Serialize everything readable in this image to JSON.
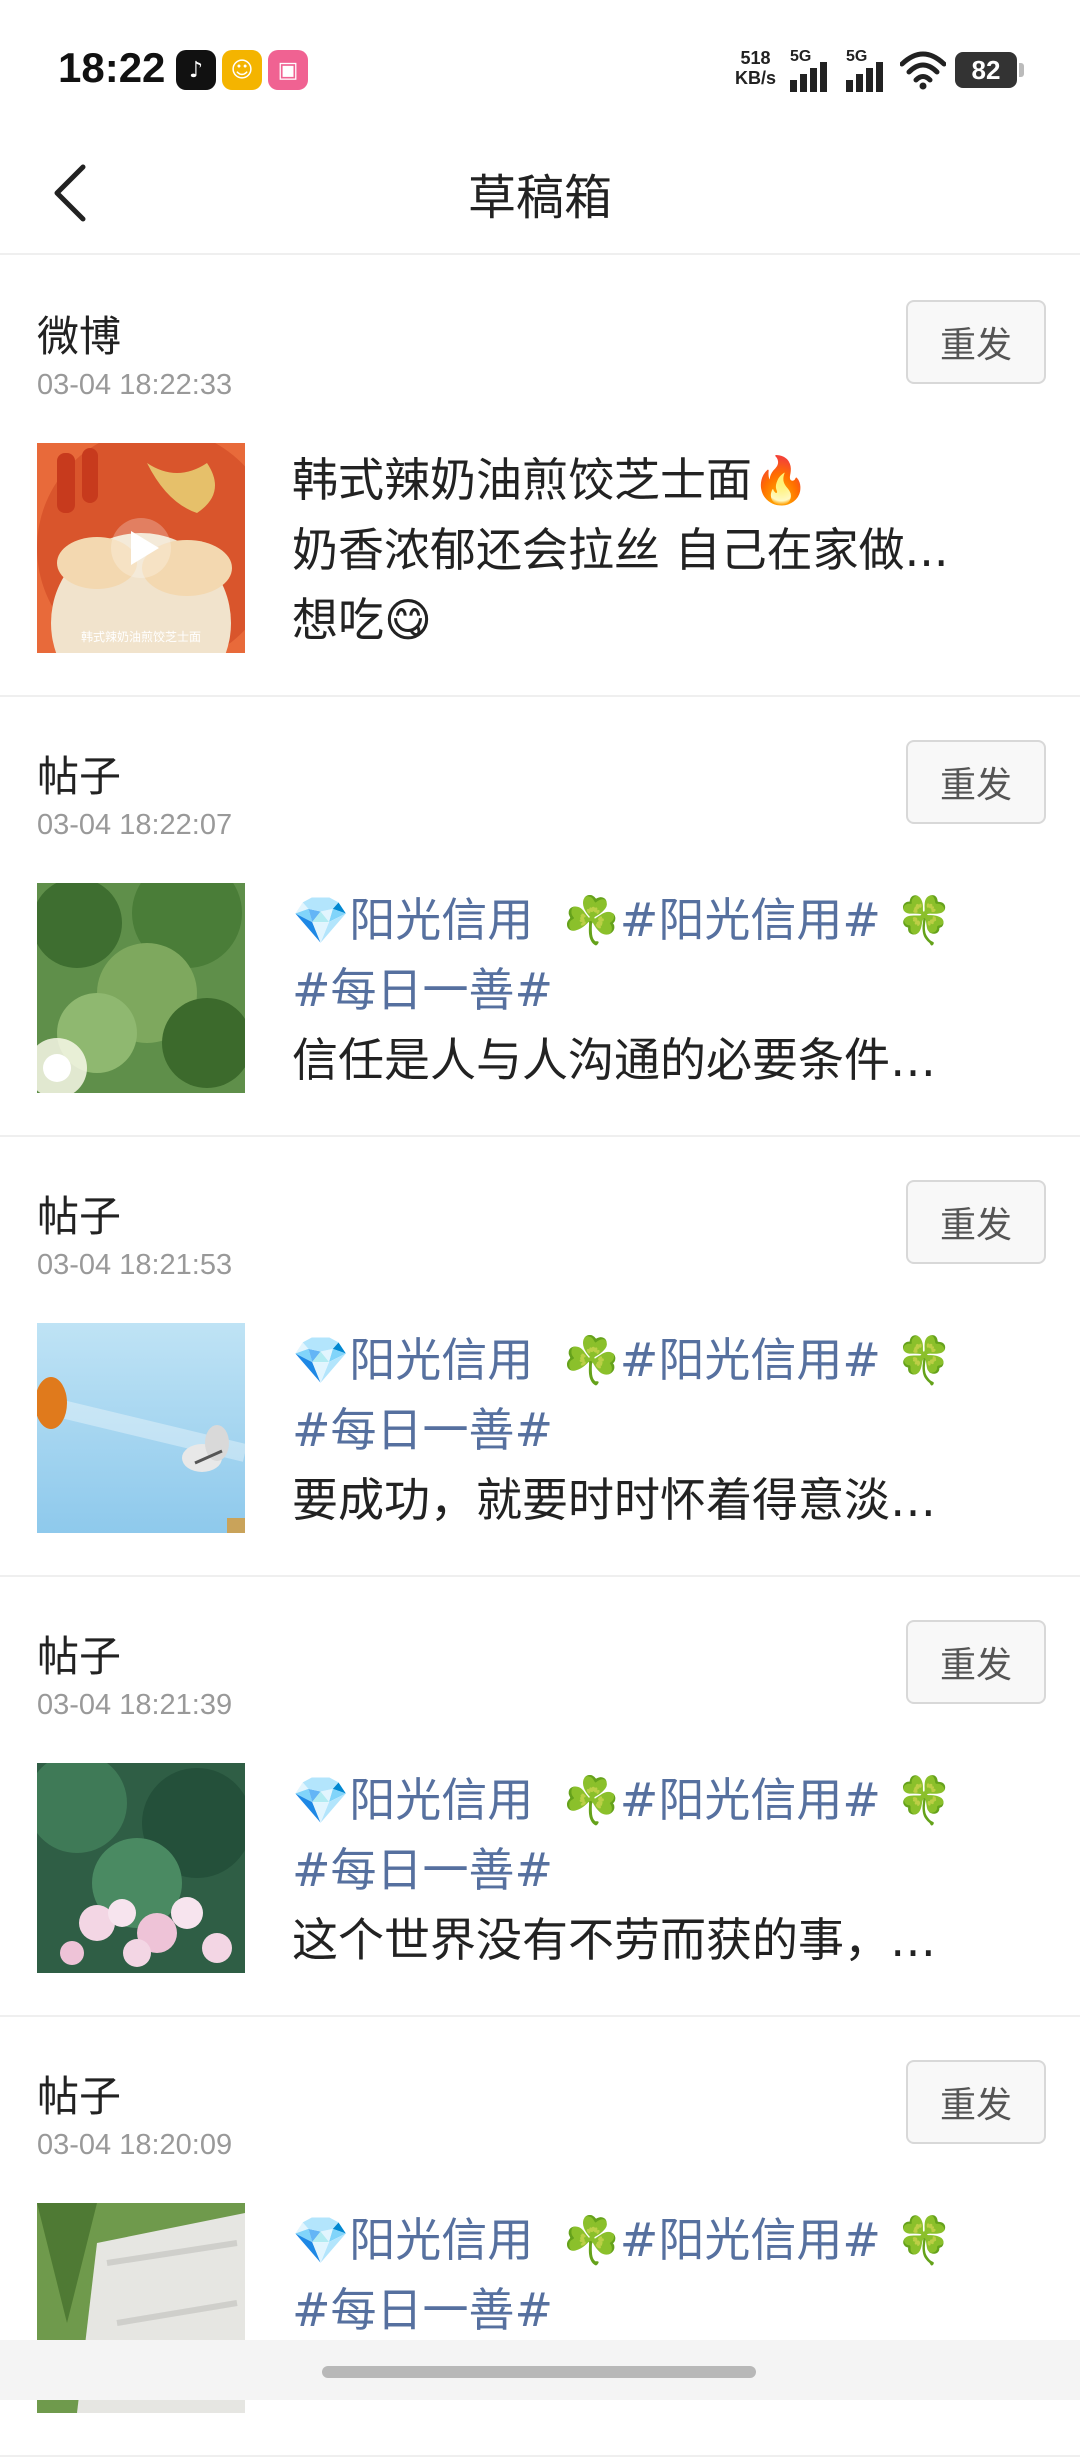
{
  "status": {
    "time": "18:22",
    "net_speed_value": "518",
    "net_speed_unit": "KB/s",
    "sim1": "5G",
    "sim2": "5G",
    "battery": "82"
  },
  "nav": {
    "title": "草稿箱"
  },
  "items": [
    {
      "source": "微博",
      "timestamp": "03-04 18:22:33",
      "resend_label": "重发",
      "line1": "韩式辣奶油煎饺芝士面🔥",
      "line2": "奶香浓郁还会拉丝 自己在家做...",
      "line3": "想吃😋",
      "thumb_caption": "韩式辣奶油煎饺芝士面"
    },
    {
      "source": "帖子",
      "timestamp": "03-04 18:22:07",
      "resend_label": "重发",
      "topic1": "💎阳光信用",
      "topic2": "☘️#阳光信用# 🍀",
      "topic3": "#每日一善#",
      "line3": "信任是人与人沟通的必要条件…"
    },
    {
      "source": "帖子",
      "timestamp": "03-04 18:21:53",
      "resend_label": "重发",
      "topic1": "💎阳光信用",
      "topic2": "☘️#阳光信用# 🍀",
      "topic3": "#每日一善#",
      "line3": "要成功，就要时时怀着得意淡…"
    },
    {
      "source": "帖子",
      "timestamp": "03-04 18:21:39",
      "resend_label": "重发",
      "topic1": "💎阳光信用",
      "topic2": "☘️#阳光信用# 🍀",
      "topic3": "#每日一善#",
      "line3": "这个世界没有不劳而获的事，…"
    },
    {
      "source": "帖子",
      "timestamp": "03-04 18:20:09",
      "resend_label": "重发",
      "topic1": "💎阳光信用",
      "topic2": "☘️#阳光信用# 🍀",
      "topic3": "#每日一善#"
    }
  ]
}
